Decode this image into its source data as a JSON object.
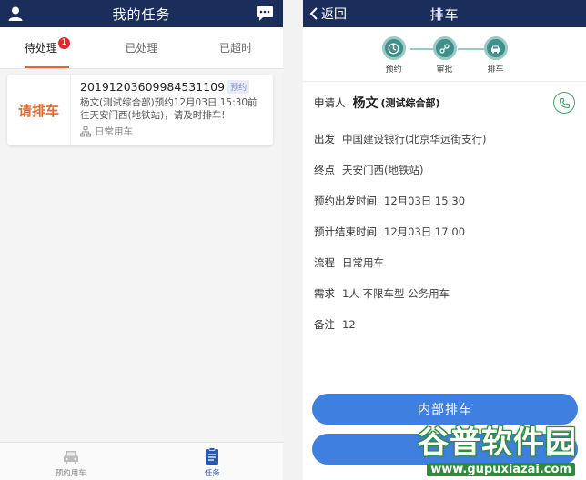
{
  "left": {
    "title": "我的任务",
    "icons": {
      "profile": "person-icon",
      "message": "chat-icon"
    },
    "tabs": [
      {
        "label": "待处理",
        "badge": "1",
        "active": true
      },
      {
        "label": "已处理",
        "active": false
      },
      {
        "label": "已超时",
        "active": false
      }
    ],
    "task": {
      "action": "请排车",
      "order_no": "20191203609984531109",
      "tag": "预约",
      "desc_line1": "杨文(测试综合部)预约12月03日 15:30前",
      "desc_line2": "往天安门西(地铁站)，请及时排车!",
      "flow": "日常用车"
    },
    "tabbar": [
      {
        "label": "预约用车",
        "icon": "car-icon",
        "active": false
      },
      {
        "label": "任务",
        "icon": "clipboard-icon",
        "active": true
      }
    ]
  },
  "right": {
    "title": "排车",
    "back_label": "返回",
    "steps": [
      {
        "label": "预约",
        "icon": "clock-icon"
      },
      {
        "label": "审批",
        "icon": "flow-icon"
      },
      {
        "label": "排车",
        "icon": "car-icon"
      }
    ],
    "applicant": {
      "label": "申请人",
      "name": "杨文",
      "dept": "(测试综合部)"
    },
    "fields": [
      {
        "label": "出发",
        "value": "中国建设银行(北京华远街支行)"
      },
      {
        "label": "终点",
        "value": "天安门西(地铁站)"
      },
      {
        "label": "预约出发时间",
        "value": "12月03日 15:30"
      },
      {
        "label": "预计结束时间",
        "value": "12月03日 17:00"
      },
      {
        "label": "流程",
        "value": "日常用车"
      },
      {
        "label": "需求",
        "value": "1人  不限车型  公务用车"
      },
      {
        "label": "备注",
        "value": "12"
      }
    ],
    "buttons": {
      "internal": "内部排车",
      "second": ""
    }
  },
  "watermark": {
    "title": "谷普软件园",
    "url": "www.gupuxiazai.com"
  },
  "colors": {
    "navbar": "#1b2e5b",
    "accent_orange": "#e06a2c",
    "button_blue": "#3f7fe0",
    "step_teal": "#3f8f8b"
  }
}
